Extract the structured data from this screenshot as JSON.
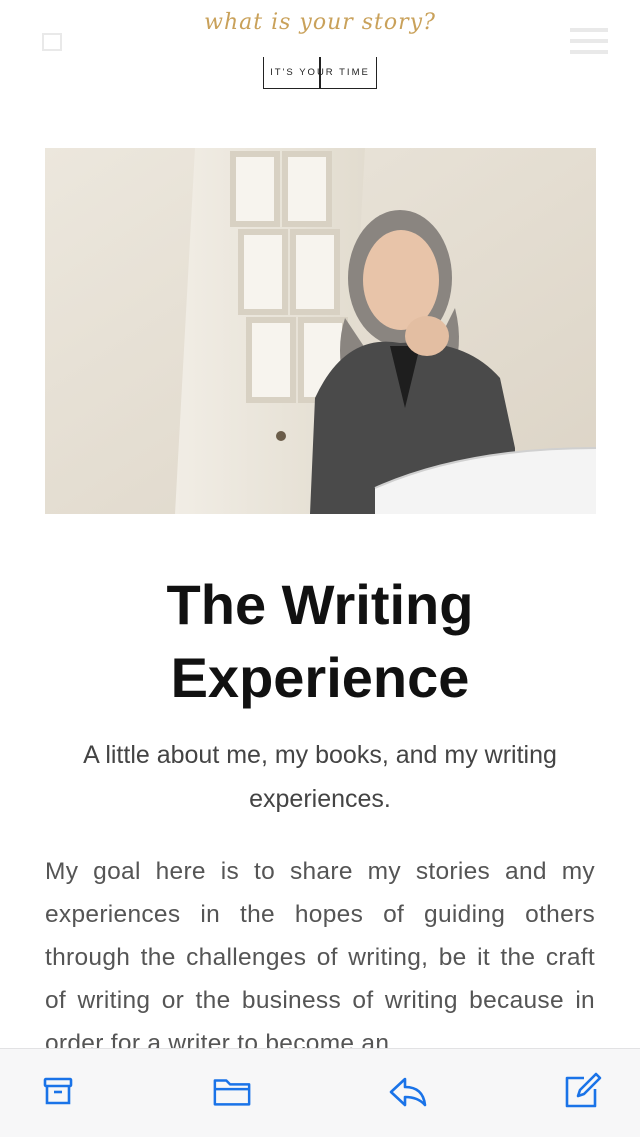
{
  "header": {
    "script_title": "what is your story?",
    "tagline": "IT'S YOUR TIME"
  },
  "hero": {
    "image_description": "portrait-photo",
    "colors": {
      "wall": "#e9e3d8",
      "door": "#f3efe7",
      "sweater": "#4a4a4a",
      "hair": "#8a8580"
    }
  },
  "main": {
    "title_line1": "The Writing",
    "title_line2": "Experience",
    "subtitle": "A little about me, my books, and my writing experiences.",
    "body": "My goal here is to share my stories and my experiences in the hopes of guiding others through the challenges of writing, be it the craft of writing or the business of writing because in order for a writer to become an"
  },
  "toolbar": {
    "items": [
      {
        "icon": "archive-icon"
      },
      {
        "icon": "folder-icon"
      },
      {
        "icon": "reply-icon"
      },
      {
        "icon": "compose-icon"
      }
    ],
    "accent": "#1a73e8"
  }
}
